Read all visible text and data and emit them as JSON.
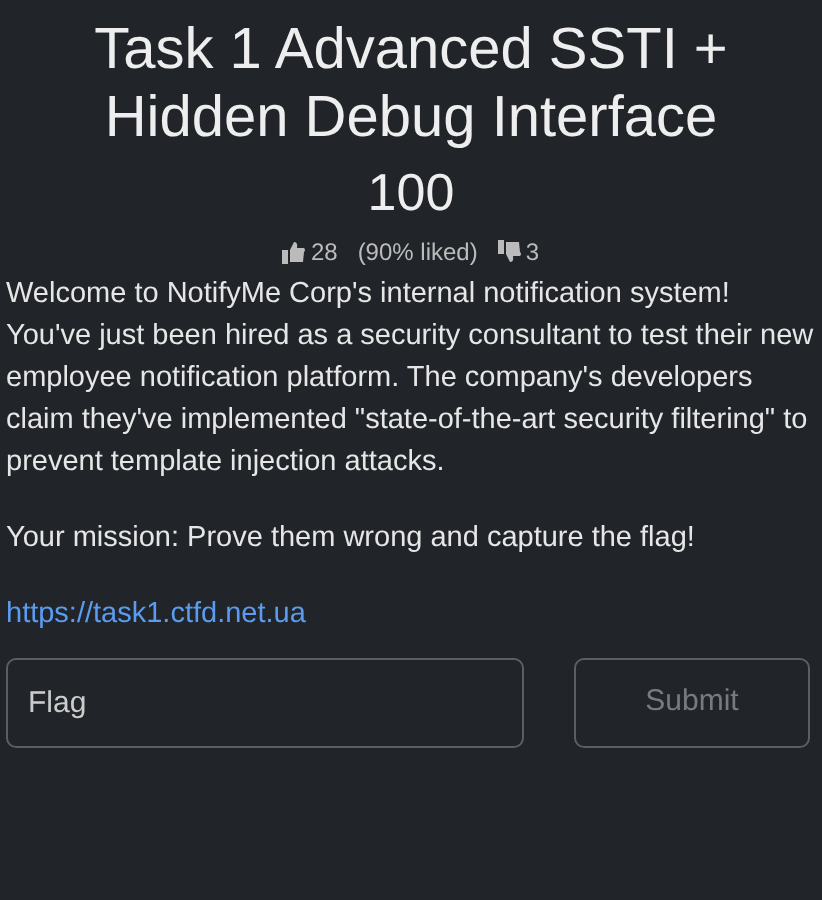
{
  "challenge": {
    "title": "Task 1 Advanced SSTI + Hidden Debug Interface",
    "points": "100"
  },
  "rating": {
    "likes": "28",
    "liked_share": "(90% liked)",
    "dislikes": "3"
  },
  "description": [
    "Welcome to NotifyMe Corp's internal notification system! You've just been hired as a security consultant to test their new employee notification platform. The company's developers claim they've implemented \"state-of-the-art security filtering\" to prevent template injection attacks.",
    "Your mission: Prove them wrong and capture the flag!"
  ],
  "link": "https://task1.ctfd.net.ua",
  "flag_field": {
    "placeholder": "Flag"
  },
  "submit_button": {
    "label": "Submit"
  }
}
